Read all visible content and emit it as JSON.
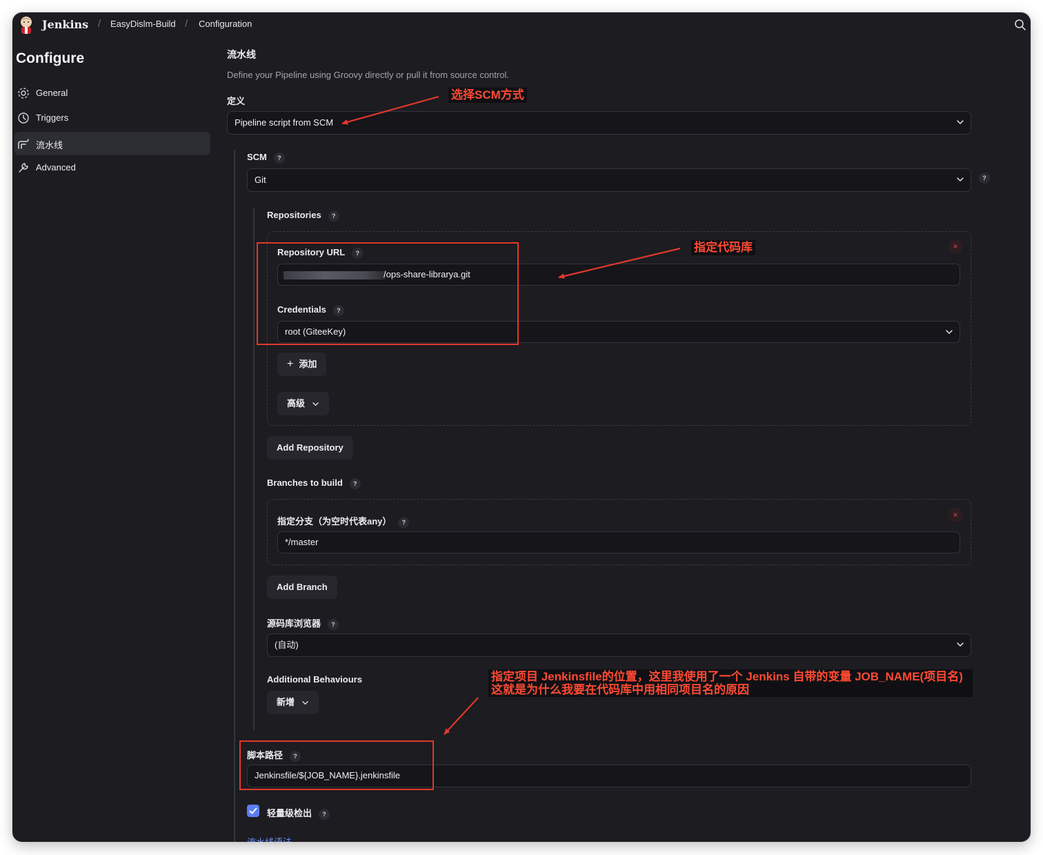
{
  "header": {
    "brand": "Jenkins",
    "breadcrumb": [
      "EasyDislm-Build",
      "Configuration"
    ],
    "separator": "/"
  },
  "sidebar": {
    "title": "Configure",
    "items": [
      {
        "label": "General",
        "icon": "gear-icon",
        "active": false
      },
      {
        "label": "Triggers",
        "icon": "clock-icon",
        "active": false
      },
      {
        "label": "流水线",
        "icon": "pipeline-icon",
        "active": true
      },
      {
        "label": "Advanced",
        "icon": "wrench-icon",
        "active": false
      }
    ]
  },
  "pipeline": {
    "section_title": "流水线",
    "description": "Define your Pipeline using Groovy directly or pull it from source control.",
    "definition_label": "定义",
    "definition_value": "Pipeline script from SCM",
    "scm_label": "SCM",
    "scm_value": "Git",
    "repositories_label": "Repositories",
    "repo_url_label": "Repository URL",
    "repo_url_value": "/ops-share-librarya.git",
    "credentials_label": "Credentials",
    "credentials_value": "root (GiteeKey)",
    "add_label": "添加",
    "advanced_label": "高级",
    "add_repository_label": "Add Repository",
    "branches_label": "Branches to build",
    "branch_specifier_label": "指定分支（为空时代表any）",
    "branch_value": "*/master",
    "add_branch_label": "Add Branch",
    "browser_label": "源码库浏览器",
    "browser_value": "(自动)",
    "behaviours_label": "Additional Behaviours",
    "behaviours_add_label": "新增",
    "script_path_label": "脚本路径",
    "script_path_value": "Jenkinsfile/${JOB_NAME}.jenkinsfile",
    "lightweight_label": "轻量级检出",
    "syntax_link": "流水线语法",
    "help_glyph": "?",
    "close_glyph": "×",
    "plus_glyph": "+"
  },
  "annotations": {
    "scm_note": "选择SCM方式",
    "repo_note": "指定代码库",
    "script_note_line1": "指定项目 Jenkinsfile的位置，这里我使用了一个 Jenkins 自带的变量 JOB_NAME(项目名)",
    "script_note_line2": "这就是为什么我要在代码库中用相同项目名的原因",
    "color": "#e2382a"
  },
  "theme": {
    "background": "#1c1c21",
    "accent": "#5d7df5",
    "danger": "#e0475a"
  }
}
